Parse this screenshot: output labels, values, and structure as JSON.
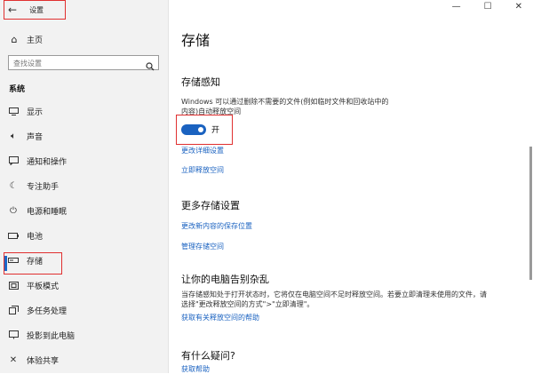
{
  "app": {
    "title": "设置"
  },
  "window_controls": [
    "—",
    "☐",
    "✕"
  ],
  "sidebar": {
    "home": "主页",
    "search_placeholder": "查找设置",
    "section": "系统",
    "items": [
      {
        "label": "显示",
        "icon": "display-icon"
      },
      {
        "label": "声音",
        "icon": "sound-icon"
      },
      {
        "label": "通知和操作",
        "icon": "notification-icon"
      },
      {
        "label": "专注助手",
        "icon": "focus-icon"
      },
      {
        "label": "电源和睡眠",
        "icon": "power-icon"
      },
      {
        "label": "电池",
        "icon": "battery-icon"
      },
      {
        "label": "存储",
        "icon": "storage-icon",
        "selected": true
      },
      {
        "label": "平板模式",
        "icon": "tablet-icon"
      },
      {
        "label": "多任务处理",
        "icon": "multitask-icon"
      },
      {
        "label": "投影到此电脑",
        "icon": "project-icon"
      },
      {
        "label": "体验共享",
        "icon": "share-icon"
      }
    ]
  },
  "main": {
    "title": "存储",
    "storage_sense": {
      "heading": "存储感知",
      "desc_line1": "Windows 可以通过删除不需要的文件(例如临时文件和回收站中的",
      "desc_line2": "内容)自动释放空间",
      "toggle_label": "开",
      "toggle_on": true,
      "link_change": "更改详细设置",
      "link_free": "立即释放空间"
    },
    "more": {
      "heading": "更多存储设置",
      "link_save_location": "更改新内容的保存位置",
      "link_manage": "管理存储空间"
    },
    "declutter": {
      "heading": "让你的电脑告别杂乱",
      "desc_line1": "当存储感知处于打开状态时，它将仅在电脑空间不足时释放空间。若要立即清理未使用的文件，请",
      "desc_line2": "选择\"更改释放空间的方式\">\"立即清理\"。",
      "link_help": "获取有关释放空间的帮助"
    },
    "questions": {
      "heading": "有什么疑问?",
      "link_help": "获取帮助"
    }
  }
}
